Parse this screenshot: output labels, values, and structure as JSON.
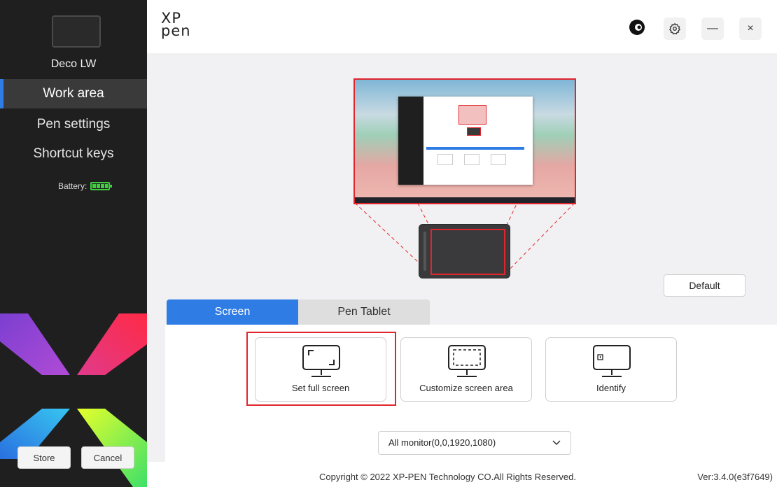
{
  "sidebar": {
    "device_name": "Deco LW",
    "nav_items": [
      {
        "label": "Work area",
        "active": true
      },
      {
        "label": "Pen settings",
        "active": false
      },
      {
        "label": "Shortcut keys",
        "active": false
      }
    ],
    "battery_label": "Battery:",
    "store_label": "Store",
    "cancel_label": "Cancel"
  },
  "header": {
    "logo_line1": "XP",
    "logo_line2": "pen",
    "icons": [
      "app-logo-icon",
      "gear-icon",
      "minimize-icon",
      "close-icon"
    ],
    "minimize_glyph": "—",
    "close_glyph": "×"
  },
  "workarea": {
    "default_label": "Default",
    "tabs": [
      {
        "label": "Screen",
        "active": true
      },
      {
        "label": "Pen Tablet",
        "active": false
      }
    ],
    "options": [
      {
        "label": "Set full screen",
        "icon": "full-screen-monitor-icon",
        "selected": true
      },
      {
        "label": "Customize screen area",
        "icon": "custom-area-monitor-icon",
        "selected": false
      },
      {
        "label": "Identify",
        "icon": "identify-monitor-icon",
        "selected": false
      }
    ],
    "monitor_select": "All monitor(0,0,1920,1080)"
  },
  "footer": {
    "copyright": "Copyright © 2022  XP-PEN Technology CO.All Rights Reserved.",
    "version": "Ver:3.4.0(e3f7649)"
  },
  "colors": {
    "accent": "#2f7ce5",
    "highlight": "#e0262c",
    "sidebar_bg": "#1f1f1f",
    "battery": "#3ed13e"
  }
}
